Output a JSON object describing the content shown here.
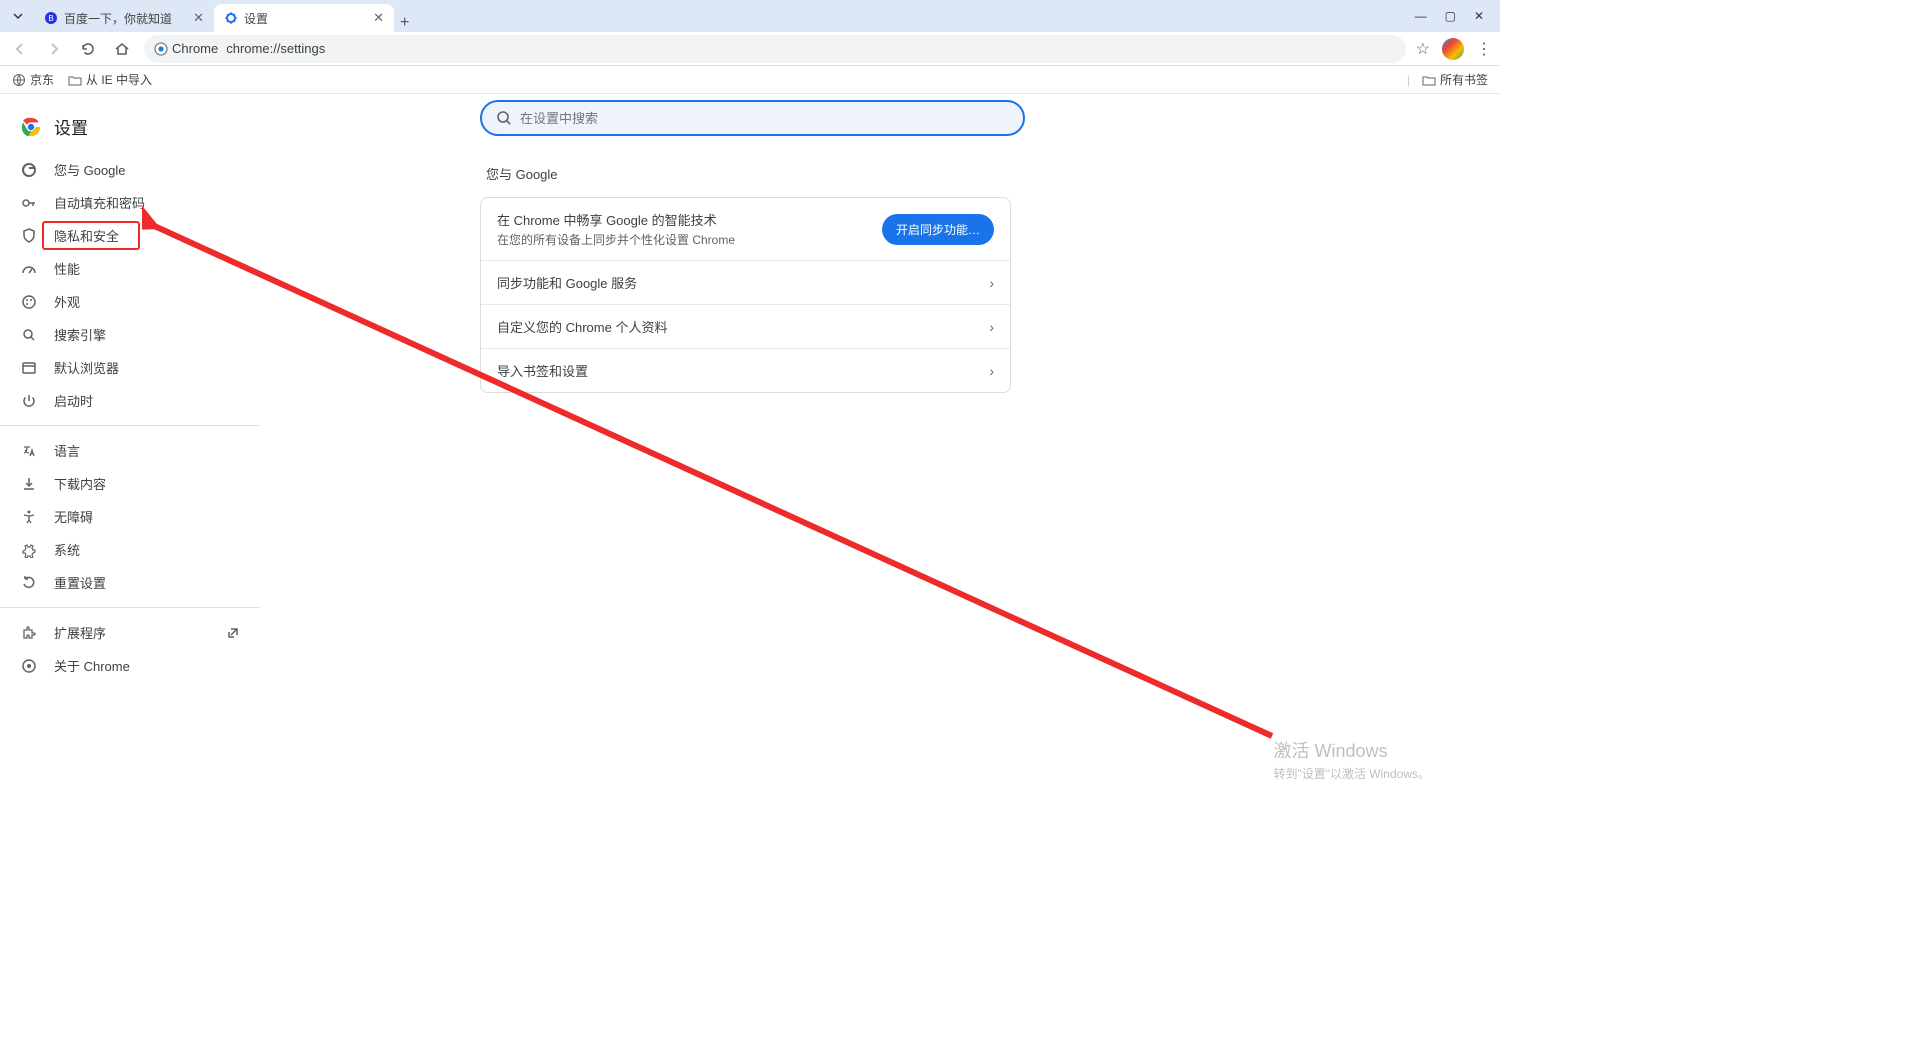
{
  "tabs": [
    {
      "title": "百度一下，你就知道",
      "active": false
    },
    {
      "title": "设置",
      "active": true
    }
  ],
  "toolbar": {
    "secure_label": "Chrome",
    "url": "chrome://settings"
  },
  "bookmarks": {
    "items": [
      {
        "label": "京东"
      },
      {
        "label": "从 IE 中导入"
      }
    ],
    "all_label": "所有书签"
  },
  "sidebar": {
    "header": "设置",
    "groups": [
      [
        {
          "label": "您与 Google",
          "icon": "google"
        },
        {
          "label": "自动填充和密码",
          "icon": "key"
        },
        {
          "label": "隐私和安全",
          "icon": "shield",
          "highlight": true
        },
        {
          "label": "性能",
          "icon": "speed"
        },
        {
          "label": "外观",
          "icon": "palette"
        },
        {
          "label": "搜索引擎",
          "icon": "search"
        },
        {
          "label": "默认浏览器",
          "icon": "browser"
        },
        {
          "label": "启动时",
          "icon": "power"
        }
      ],
      [
        {
          "label": "语言",
          "icon": "lang"
        },
        {
          "label": "下载内容",
          "icon": "download"
        },
        {
          "label": "无障碍",
          "icon": "accessibility"
        },
        {
          "label": "系统",
          "icon": "system"
        },
        {
          "label": "重置设置",
          "icon": "reset"
        }
      ],
      [
        {
          "label": "扩展程序",
          "icon": "extension",
          "external": true
        },
        {
          "label": "关于 Chrome",
          "icon": "chrome"
        }
      ]
    ]
  },
  "main": {
    "search_placeholder": "在设置中搜索",
    "section_title": "您与 Google",
    "sync_title": "在 Chrome 中畅享 Google 的智能技术",
    "sync_sub": "在您的所有设备上同步并个性化设置 Chrome",
    "sync_button": "开启同步功能…",
    "rows": [
      "同步功能和 Google 服务",
      "自定义您的 Chrome 个人资料",
      "导入书签和设置"
    ]
  },
  "watermark": {
    "line1": "激活 Windows",
    "line2": "转到\"设置\"以激活 Windows。"
  }
}
